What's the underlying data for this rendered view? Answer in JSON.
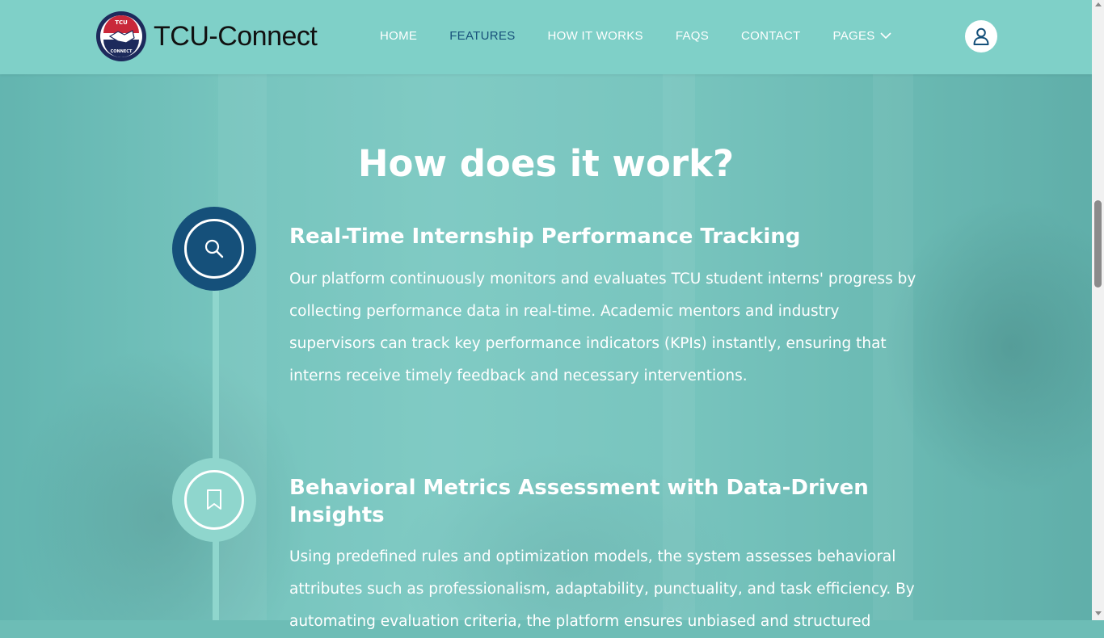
{
  "brand": {
    "name": "TCU-Connect",
    "badge_top": "TCU",
    "badge_bottom": "CONNECT"
  },
  "nav": {
    "items": [
      {
        "label": "HOME",
        "active": false
      },
      {
        "label": "FEATURES",
        "active": true
      },
      {
        "label": "HOW IT WORKS",
        "active": false
      },
      {
        "label": "FAQS",
        "active": false
      },
      {
        "label": "CONTACT",
        "active": false
      },
      {
        "label": "PAGES",
        "active": false,
        "has_dropdown": true
      }
    ],
    "user_icon": "user-icon"
  },
  "section": {
    "title": "How does it work?",
    "steps": [
      {
        "icon": "search-icon",
        "title": "Real-Time Internship Performance Tracking",
        "text": "Our platform continuously monitors and evaluates TCU student interns' progress by collecting performance data in real-time. Academic mentors and industry supervisors can track key performance indicators (KPIs) instantly, ensuring that interns receive timely feedback and necessary interventions."
      },
      {
        "icon": "bookmark-icon",
        "title": "Behavioral Metrics Assessment with Data-Driven Insights",
        "text": "Using predefined rules and optimization models, the system assesses behavioral attributes such as professionalism, adaptability, punctuality, and task efficiency. By automating evaluation criteria, the platform ensures unbiased and structured"
      }
    ]
  },
  "colors": {
    "header_bg": "#7fd0c8",
    "accent_dark": "#15507a",
    "accent_light": "#8fd6cd",
    "text_light": "#ffffff"
  }
}
